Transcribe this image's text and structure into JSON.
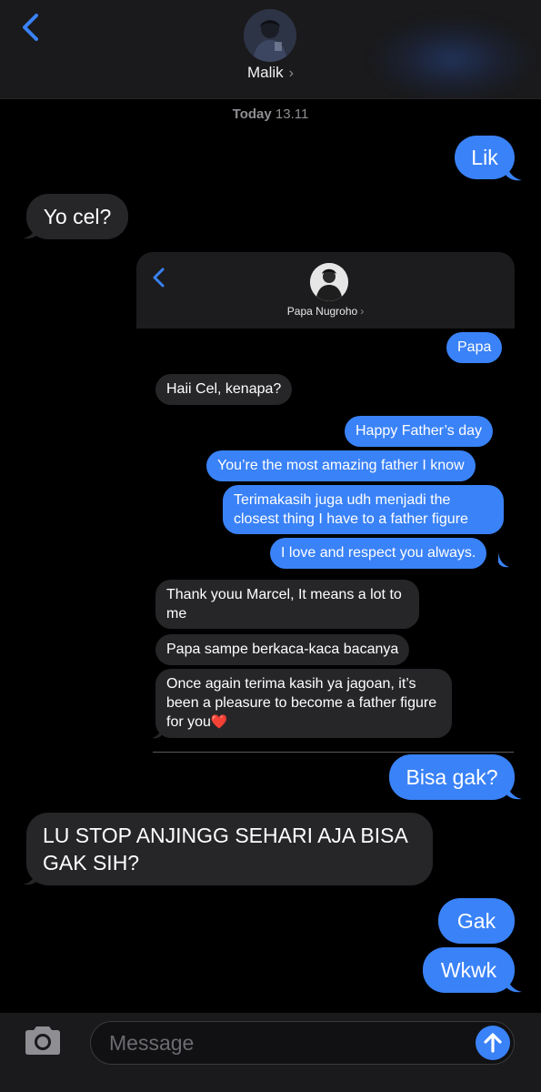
{
  "header": {
    "contact_name": "Malik",
    "chevron": "›"
  },
  "timestamp": {
    "day": "Today",
    "time": "13.11"
  },
  "messages": [
    {
      "side": "out",
      "text": "Lik"
    },
    {
      "side": "in",
      "text": "Yo cel?"
    },
    {
      "side": "out",
      "text": "Bisa gak?"
    },
    {
      "side": "in",
      "text": "LU STOP ANJINGG SEHARI AJA BISA GAK SIH?"
    },
    {
      "side": "out",
      "text": "Gak"
    },
    {
      "side": "out",
      "text": "Wkwk"
    }
  ],
  "embedded_screenshot": {
    "contact_name": "Papa Nugroho",
    "chevron": "›",
    "messages": [
      {
        "side": "out",
        "text": "Papa"
      },
      {
        "side": "in",
        "text": "Haii Cel, kenapa?"
      },
      {
        "side": "out",
        "text": "Happy Father’s day"
      },
      {
        "side": "out",
        "text": "You’re the most amazing father I know"
      },
      {
        "side": "out",
        "text": "Terimakasih juga udh menjadi the closest thing I have to a father figure"
      },
      {
        "side": "out",
        "text": "I love and respect you always."
      },
      {
        "side": "in",
        "text": "Thank youu Marcel, It means a lot to me"
      },
      {
        "side": "in",
        "text": "Papa sampe berkaca-kaca bacanya"
      },
      {
        "side": "in",
        "text": "Once again terima kasih ya jagoan, it’s been a pleasure to become a father figure for you"
      }
    ],
    "emoji": "❤️"
  },
  "input_bar": {
    "placeholder": "Message"
  },
  "colors": {
    "accent": "#3a82f7",
    "incoming_bubble": "#262629",
    "background": "#000000"
  },
  "icons": [
    "back-chevron-icon",
    "camera-icon",
    "send-arrow-icon",
    "heart-emoji"
  ]
}
